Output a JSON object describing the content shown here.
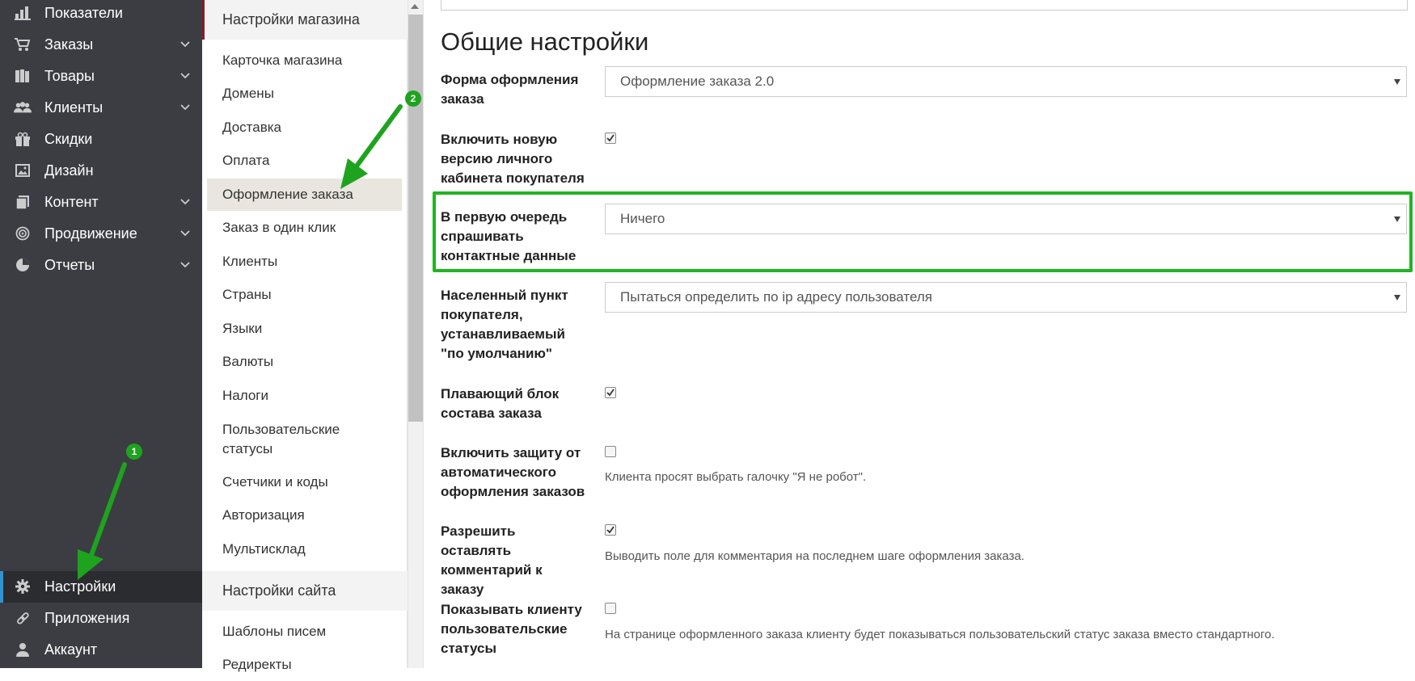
{
  "sidebar": {
    "items": [
      {
        "label": "Показатели",
        "icon": "bar-chart-icon"
      },
      {
        "label": "Заказы",
        "icon": "cart-icon"
      },
      {
        "label": "Товары",
        "icon": "books-icon"
      },
      {
        "label": "Клиенты",
        "icon": "users-icon"
      },
      {
        "label": "Скидки",
        "icon": "gift-icon"
      },
      {
        "label": "Дизайн",
        "icon": "image-icon"
      },
      {
        "label": "Контент",
        "icon": "pages-icon"
      },
      {
        "label": "Продвижение",
        "icon": "target-icon"
      },
      {
        "label": "Отчеты",
        "icon": "pie-chart-icon"
      },
      {
        "label": "Настройки",
        "icon": "gear-icon"
      },
      {
        "label": "Приложения",
        "icon": "link-icon"
      },
      {
        "label": "Аккаунт",
        "icon": "user-icon"
      }
    ]
  },
  "subnav": {
    "store_settings_title": "Настройки магазина",
    "items": [
      "Карточка магазина",
      "Домены",
      "Доставка",
      "Оплата",
      "Оформление заказа",
      "Заказ в один клик",
      "Клиенты",
      "Страны",
      "Языки",
      "Валюты",
      "Налоги",
      "Пользовательские статусы",
      "Счетчики и коды",
      "Авторизация",
      "Мультисклад"
    ],
    "site_settings_title": "Настройки сайта",
    "site_items": [
      "Шаблоны писем",
      "Редиректы"
    ]
  },
  "main": {
    "title": "Общие настройки",
    "rows": {
      "checkout_form": {
        "label": "Форма оформления заказа",
        "value": "Оформление заказа 2.0"
      },
      "new_account": {
        "label": "Включить новую версию личного кабинета покупателя",
        "checked": true
      },
      "contact_first": {
        "label": "В первую очередь спрашивать контактные данные",
        "value": "Ничего"
      },
      "locality": {
        "label": "Населенный пункт покупателя, устанавливаемый \"по умолчанию\"",
        "value": "Пытаться определить по ip адресу пользователя"
      },
      "floating_block": {
        "label": "Плавающий блок состава заказа",
        "checked": true
      },
      "robot_protection": {
        "label": "Включить защиту от автоматического оформления заказов",
        "checked": false,
        "hint": "Клиента просят выбрать галочку \"Я не робот\"."
      },
      "allow_comment": {
        "label": "Разрешить оставлять комментарий к заказу",
        "checked": true,
        "hint": "Выводить поле для комментария на последнем шаге оформления заказа."
      },
      "custom_statuses": {
        "label": "Показывать клиенту пользовательские статусы",
        "checked": false,
        "hint": "На странице оформленного заказа клиенту будет показываться пользовательский статус заказа вместо стандартного."
      }
    }
  },
  "annotations": {
    "badge_1": "1",
    "badge_2": "2"
  },
  "colors": {
    "sidebar_bg": "#3b3d42",
    "active_accent": "#2a96d6",
    "highlight": "#22b422",
    "store_accent": "#8a1c2a"
  }
}
